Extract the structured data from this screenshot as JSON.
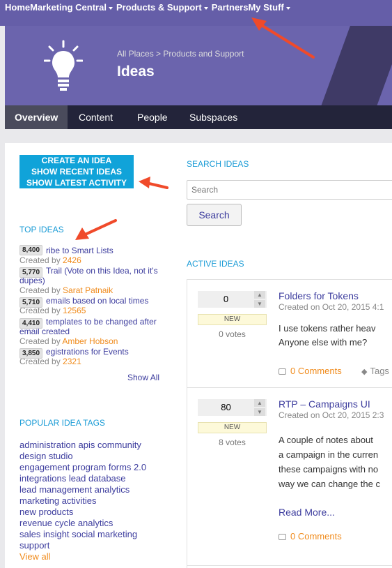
{
  "topnav": {
    "items": [
      {
        "label": "Home"
      },
      {
        "label": "Marketing Central",
        "caret": true
      },
      {
        "label": "Products & Support",
        "caret": true
      },
      {
        "label": "Partners"
      },
      {
        "label": "My Stuff",
        "caret": true
      }
    ]
  },
  "hero": {
    "breadcrumb_root": "All Places",
    "breadcrumb_sep": ">",
    "breadcrumb_current": "Products and Support",
    "title": "Ideas"
  },
  "tabs": [
    "Overview",
    "Content",
    "People",
    "Subspaces"
  ],
  "left": {
    "create_lines": [
      "CREATE AN IDEA",
      "SHOW RECENT IDEAS",
      "SHOW LATEST ACTIVITY"
    ],
    "top_ideas_heading": "TOP IDEAS",
    "top_ideas": [
      {
        "score": "8,400",
        "title": "ribe to Smart Lists",
        "created_prefix": "Created by",
        "author": "2426"
      },
      {
        "score": "5,770",
        "title": "Trail (Vote on this Idea, not it's dupes)",
        "created_prefix": "Created by",
        "author": "Sarat Patnaik"
      },
      {
        "score": "5,710",
        "title": "emails based on local times",
        "created_prefix": "Created by",
        "author": "12565"
      },
      {
        "score": "4,410",
        "title": "templates to be changed after email created",
        "created_prefix": "Created by",
        "author": "Amber Hobson"
      },
      {
        "score": "3,850",
        "title": "egistrations for Events",
        "created_prefix": "Created by",
        "author": "2321"
      }
    ],
    "show_all": "Show All",
    "tags_heading": "POPULAR IDEA TAGS",
    "tag_lines": [
      "administration apis community",
      "design studio",
      "engagement program forms 2.0",
      "integrations lead database",
      "lead management analytics",
      "marketing activities",
      "new products",
      "revenue cycle analytics",
      "sales insight social marketing",
      "support"
    ],
    "view_all": "View all"
  },
  "right": {
    "search_heading": "SEARCH IDEAS",
    "search_placeholder": "Search",
    "search_button": "Search",
    "active_heading": "ACTIVE IDEAS",
    "ideas": [
      {
        "votes": "0",
        "status": "NEW",
        "votes_label": "0 votes",
        "title": "Folders for Tokens",
        "date": "Created on Oct 20, 2015 4:1",
        "body": [
          "I use tokens rather heav",
          "Anyone else with me?"
        ],
        "comments": "0 Comments",
        "tags": "Tags"
      },
      {
        "votes": "80",
        "status": "NEW",
        "votes_label": "8 votes",
        "title": "RTP – Campaigns UI",
        "date": "Created on Oct 20, 2015 2:3",
        "body": [
          "A couple of notes about",
          "a campaign in the curren",
          "these campaigns with no",
          "way we can change the c"
        ],
        "read_more": "Read More...",
        "comments": "0 Comments"
      }
    ]
  },
  "colors": {
    "topnav_bg": "#655ea8",
    "hero_bg": "#6b64ad",
    "tabs_bg": "#23243a",
    "accent_blue": "#10a3d9",
    "link_purple": "#3d3d9e",
    "orange": "#f08b1c",
    "annotation_red": "#f04a2a"
  }
}
